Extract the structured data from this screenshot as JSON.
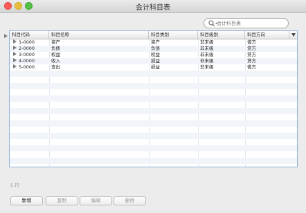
{
  "window": {
    "title": "会计科目表"
  },
  "search": {
    "placeholder": "会计科目表"
  },
  "table": {
    "columns": [
      "科目代码",
      "科目名称",
      "科目类别",
      "科目级别",
      "科目方向"
    ],
    "rows": [
      {
        "code": "1-0000",
        "name": "资产",
        "category": "资产",
        "level": "非末级",
        "direction": "借方"
      },
      {
        "code": "2-0000",
        "name": "负债",
        "category": "负债",
        "level": "非末级",
        "direction": "贷方"
      },
      {
        "code": "3-0000",
        "name": "权益",
        "category": "权益",
        "level": "非末级",
        "direction": "贷方"
      },
      {
        "code": "4-0000",
        "name": "收入",
        "category": "损益",
        "level": "非末级",
        "direction": "贷方"
      },
      {
        "code": "5-0000",
        "name": "支出",
        "category": "损益",
        "level": "非末级",
        "direction": "借方"
      }
    ]
  },
  "status": {
    "row_count": "5 行"
  },
  "buttons": {
    "new": "新增",
    "copy": "复制",
    "edit": "编辑",
    "delete": "删除"
  },
  "colors": {
    "grid_border": "#8fb0d8",
    "alt_row": "#f1f5fa",
    "close": "#fc5b57",
    "minimize": "#e5bf3c",
    "maximize": "#56c046"
  },
  "icons": {
    "search": "magnifier-icon",
    "expand": "disclosure-triangle-icon",
    "column_menu": "chevron-down-icon"
  }
}
